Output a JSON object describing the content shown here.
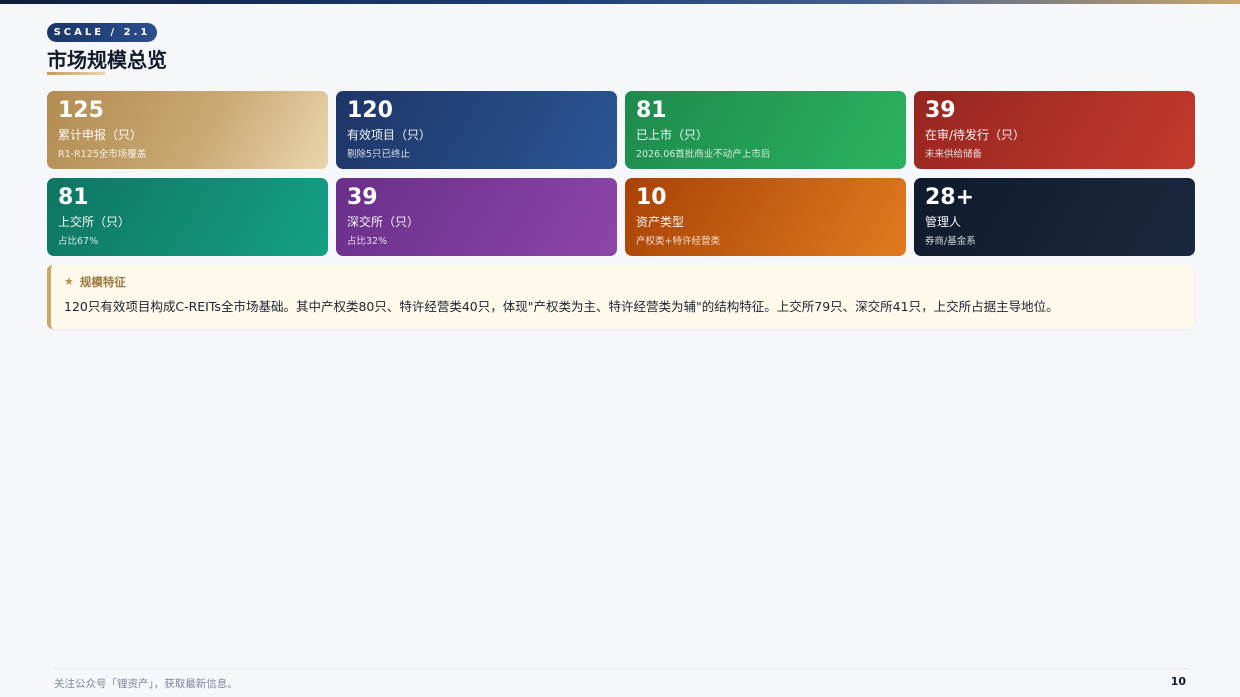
{
  "header": {
    "badge": "SCALE / 2.1",
    "title": "市场规模总览"
  },
  "cards": [
    {
      "value": "125",
      "label": "累计申报（只）",
      "sub": "R1-R125全市场覆盖",
      "color": "#b28c51"
    },
    {
      "value": "120",
      "label": "有效项目（只）",
      "sub": "剔除5只已终止",
      "color": "#1e3566"
    },
    {
      "value": "81",
      "label": "已上市（只）",
      "sub": "2026.06首批商业不动产上市后",
      "color": "#1e8a4d"
    },
    {
      "value": "39",
      "label": "在审/待发行（只）",
      "sub": "未来供给储备",
      "color": "#962620"
    },
    {
      "value": "81",
      "label": "上交所（只）",
      "sub": "占比67%",
      "color": "#0e7561"
    },
    {
      "value": "39",
      "label": "深交所（只）",
      "sub": "占比32%",
      "color": "#6a2f8a"
    },
    {
      "value": "10",
      "label": "资产类型",
      "sub": "产权类+特许经营类",
      "color": "#a94205"
    },
    {
      "value": "28+",
      "label": "管理人",
      "sub": "券商/基金系",
      "color": "#0f1a2c"
    }
  ],
  "feature": {
    "icon": "star-icon",
    "heading": "规模特征",
    "text": "120只有效项目构成C-REITs全市场基础。其中产权类80只、特许经营类40只，体现\"产权类为主、特许经营类为辅\"的结构特征。上交所79只、深交所41只，上交所占据主导地位。"
  },
  "footer": {
    "note": "关注公众号「锂资产」，获取最新信息。",
    "page": "10"
  }
}
